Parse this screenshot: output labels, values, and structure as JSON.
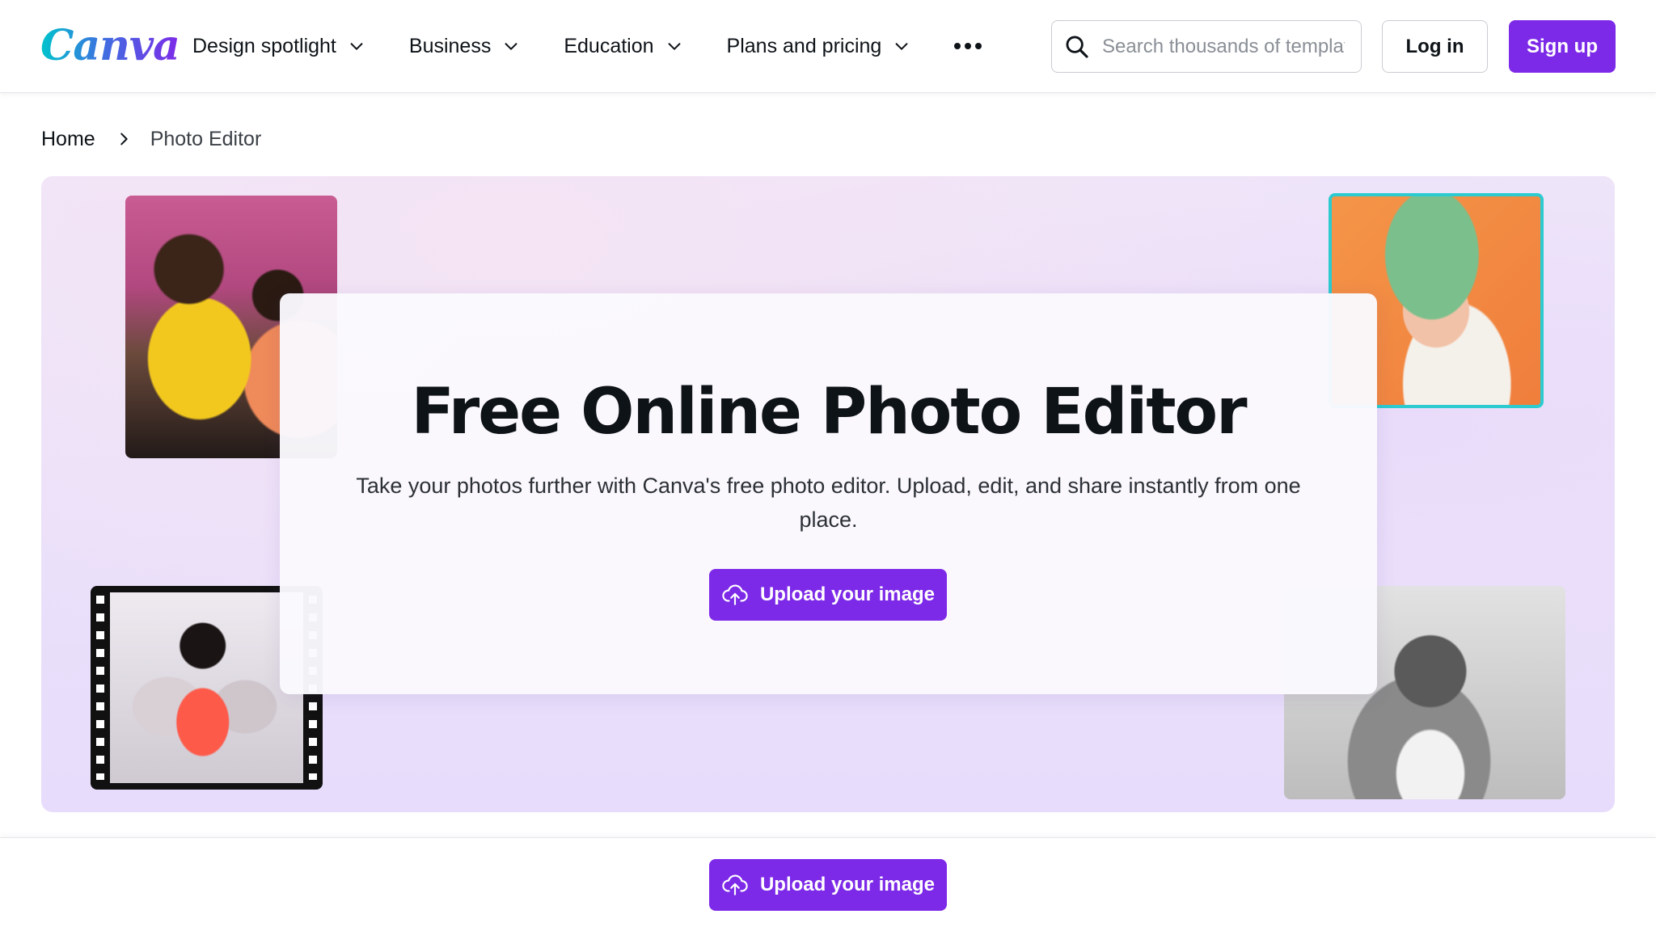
{
  "brand": {
    "logo_text": "Canva",
    "accent_color": "#7d2ae8",
    "accent_teal": "#00c4cc"
  },
  "nav": {
    "items": [
      {
        "label": "Design spotlight",
        "icon": "chevron-down-icon"
      },
      {
        "label": "Business",
        "icon": "chevron-down-icon"
      },
      {
        "label": "Education",
        "icon": "chevron-down-icon"
      },
      {
        "label": "Plans and pricing",
        "icon": "chevron-down-icon"
      }
    ],
    "more_icon": "more-horizontal-icon"
  },
  "search": {
    "placeholder": "Search thousands of templates",
    "icon": "search-icon"
  },
  "auth": {
    "login_label": "Log in",
    "signup_label": "Sign up"
  },
  "breadcrumb": {
    "home": "Home",
    "separator_icon": "chevron-right-icon",
    "current": "Photo Editor"
  },
  "hero": {
    "title": "Free Online Photo Editor",
    "subtitle": "Take your photos further with Canva's free photo editor. Upload, edit, and share instantly from one place.",
    "cta_label": "Upload your image",
    "cta_icon": "cloud-upload-icon"
  },
  "sticky_bar": {
    "cta_label": "Upload your image",
    "cta_icon": "cloud-upload-icon"
  }
}
